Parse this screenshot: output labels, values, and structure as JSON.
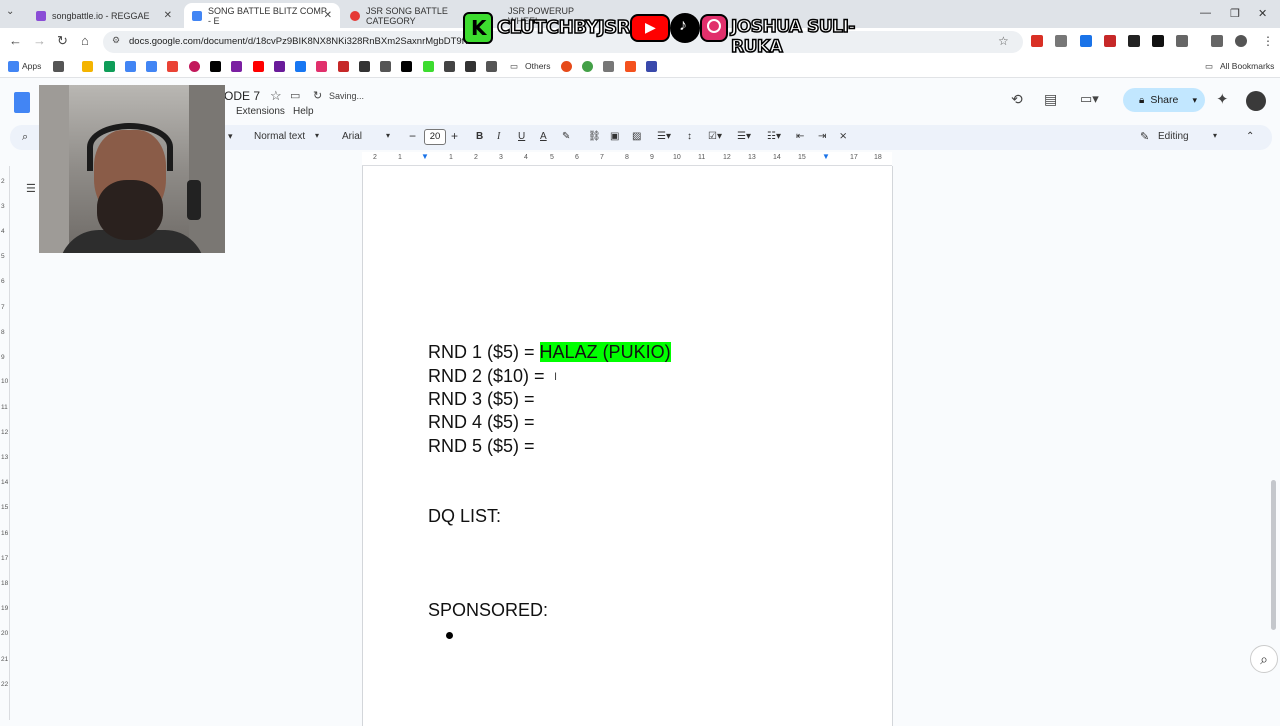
{
  "tabs": [
    {
      "label": "songbattle.io - REGGAE",
      "active": false
    },
    {
      "label": "SONG BATTLE BLITZ COMP - E",
      "active": true
    },
    {
      "label": "JSR SONG BATTLE CATEGORY",
      "active": false
    },
    {
      "label": "JSR POWERUP WHEEL",
      "active": false
    }
  ],
  "address": {
    "url": "docs.google.com/document/d/18cvPz9BIK8NX8NKi328RnBXm2SaxnrMgbDT9fvbu"
  },
  "bookmarks": {
    "apps_label": "Apps",
    "others_label": "Others",
    "all_label": "All Bookmarks"
  },
  "docs": {
    "title": "ODE 7",
    "saving": "Saving...",
    "menu": {
      "extensions": "Extensions",
      "help": "Help"
    },
    "share_label": "Share",
    "toolbar": {
      "style": "Normal text",
      "font": "Arial",
      "font_size": "20",
      "mode": "Editing"
    }
  },
  "ruler_ticks": [
    "2",
    "1",
    "1",
    "2",
    "3",
    "4",
    "5",
    "6",
    "7",
    "8",
    "9",
    "10",
    "11",
    "12",
    "13",
    "14",
    "15",
    "16",
    "17",
    "18"
  ],
  "vruler_ticks": [
    "2",
    "3",
    "4",
    "5",
    "6",
    "7",
    "8",
    "9",
    "10",
    "11",
    "12",
    "13",
    "14",
    "15",
    "16",
    "17",
    "18",
    "19",
    "20",
    "21",
    "22"
  ],
  "content": {
    "rnd1_prefix": "RND 1 ($5) = ",
    "rnd1_value": "HALAZ (PUKIO)",
    "rnd2": "RND 2 ($10) =",
    "rnd3": "RND 3 ($5) =",
    "rnd4": "RND 4 ($5) =",
    "rnd5": "RND 5 ($5) =",
    "dq_list": "DQ LIST:",
    "sponsored": "SPONSORED:"
  },
  "overlay": {
    "brand": "CLUTCHBYJSR",
    "name": "JOSHUA SULI-RUKA",
    "colors": {
      "brand_green": "#3ddc2f",
      "youtube_red": "#ff0000",
      "tiktok_black": "#000000",
      "instagram_pink": "#e1306c"
    }
  },
  "colors": {
    "highlight": "#00ff00",
    "share_bg": "#c2e7ff",
    "tab_bar": "#dfe3e8"
  }
}
